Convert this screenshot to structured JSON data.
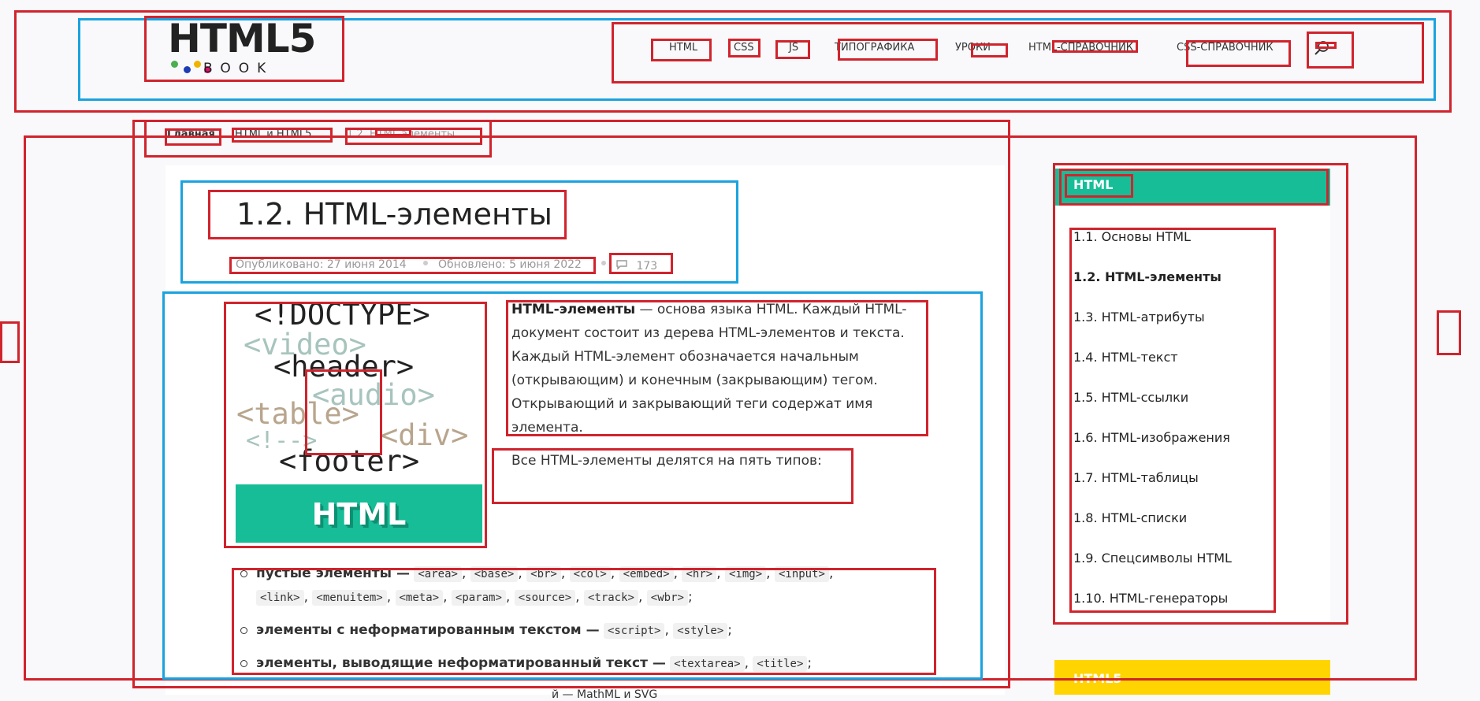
{
  "header": {
    "logo": {
      "title": "HTML5",
      "subtitle": "BOOK"
    },
    "nav": [
      "HTML",
      "CSS",
      "JS",
      "ТИПОГРАФИКА",
      "УРОКИ",
      "HTML-СПРАВОЧНИК",
      "CSS-СПРАВОЧНИК"
    ]
  },
  "breadcrumb": [
    "Главная",
    "HTML и HTML5",
    "1.2. HTML-элементы"
  ],
  "article": {
    "title": "1.2. HTML-элементы",
    "published": "Опубликовано: 27 июня 2014",
    "updated": "Обновлено: 5 июня 2022",
    "comments": "173",
    "image": {
      "lines": [
        "<!DOCTYPE>",
        "<video>",
        "<header>",
        "<audio>",
        "<table>",
        "<!-->",
        "<div>",
        "<footer>"
      ],
      "banner": "HTML"
    },
    "intro_bold": "HTML-элементы",
    "intro_rest": " — основа языка HTML. Каждый HTML-документ состоит из дерева HTML-элементов и текста. Каждый HTML-элемент обозначается начальным (открывающим) и конечным (закрывающим) тегом. Открывающий и закрывающий теги содержат имя элемента.",
    "types_intro": "Все HTML-элементы делятся на пять типов:",
    "list": [
      {
        "label": "пустые элементы —",
        "codes": [
          "<area>",
          "<base>",
          "<br>",
          "<col>",
          "<embed>",
          "<hr>",
          "<img>",
          "<input>",
          "<link>",
          "<menuitem>",
          "<meta>",
          "<param>",
          "<source>",
          "<track>",
          "<wbr>"
        ]
      },
      {
        "label": "элементы с неформатированным текстом —",
        "codes": [
          "<script>",
          "<style>"
        ]
      },
      {
        "label": "элементы, выводящие неформатированный текст —",
        "codes": [
          "<textarea>",
          "<title>"
        ]
      }
    ],
    "cut_text": "й — MathML и SVG"
  },
  "sidebar": {
    "heading": "HTML",
    "items": [
      "1.1. Основы HTML",
      "1.2. HTML-элементы",
      "1.3. HTML-атрибуты",
      "1.4. HTML-текст",
      "1.5. HTML-ссылки",
      "1.6. HTML-изображения",
      "1.7. HTML-таблицы",
      "1.8. HTML-списки",
      "1.9. Спецсимволы HTML",
      "1.10. HTML-генераторы"
    ],
    "active_index": 1,
    "next_heading": "HTML5"
  },
  "colors": {
    "accent": "#16bd97",
    "yellow": "#ffd400",
    "annotation_red": "#d0242d",
    "annotation_blue": "#1aa3df"
  }
}
